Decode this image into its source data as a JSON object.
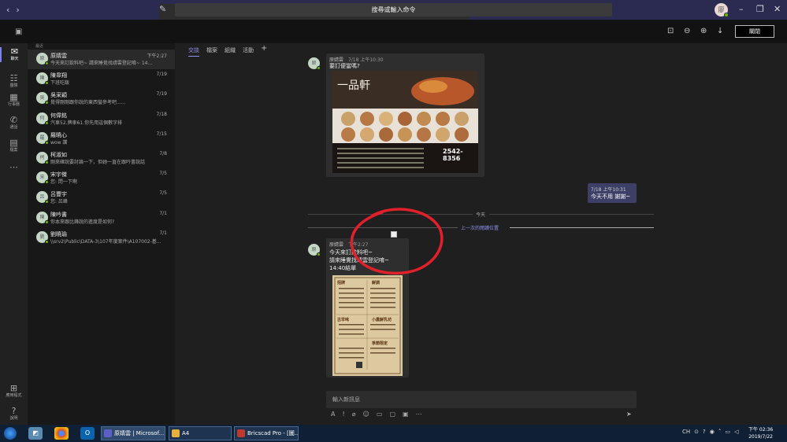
{
  "titlebar": {
    "search_placeholder": "搜尋或輸入命令",
    "avatar_initial": "廖"
  },
  "viewer_toolbar": {
    "close_label": "關閉"
  },
  "rail": [
    {
      "label": "聊天",
      "icon": "chat-icon",
      "glyph": "✉",
      "active": true
    },
    {
      "label": "團隊",
      "icon": "teams-icon",
      "glyph": "☷",
      "active": false
    },
    {
      "label": "行事曆",
      "icon": "calendar-icon",
      "glyph": "▦",
      "active": false
    },
    {
      "label": "通話",
      "icon": "phone-icon",
      "glyph": "✆",
      "active": false
    },
    {
      "label": "檔案",
      "icon": "files-icon",
      "glyph": "▤",
      "active": false
    },
    {
      "label": "",
      "icon": "more-icon",
      "glyph": "⋯",
      "active": false
    },
    {
      "label": "應用程式",
      "icon": "apps-icon",
      "glyph": "⊞",
      "active": false
    },
    {
      "label": "說明",
      "icon": "help-icon",
      "glyph": "?",
      "active": false
    }
  ],
  "chatlist": {
    "header": "最近",
    "chats": [
      {
        "name": "原婧雲",
        "preview": "今天來訂飲料吧~ 請來睡覺找靖雲登記唷~ 14...",
        "date": "下午2:27",
        "initial": "原",
        "selected": true
      },
      {
        "name": "陳韋翔",
        "preview": "下班吃飯",
        "date": "7/19",
        "initial": "陳",
        "selected": false
      },
      {
        "name": "吳采穎",
        "preview": "覺得剛剛跟你說的東西蠻參考吧......",
        "date": "7/19",
        "initial": "吳",
        "selected": false
      },
      {
        "name": "何偉銘",
        "preview": "汽車52.牌車61.你先用這個數字排",
        "date": "7/18",
        "initial": "何",
        "selected": false
      },
      {
        "name": "羅曉心",
        "preview": "wow 讚",
        "date": "7/15",
        "initial": "羅",
        "selected": false
      },
      {
        "name": "柯淑如",
        "preview": "剛來確說要討論一下，但她一直在跟吟書說話",
        "date": "7/8",
        "initial": "柯",
        "selected": false
      },
      {
        "name": "宋宇傑",
        "preview": "您: 問一下啊",
        "date": "7/5",
        "initial": "宋",
        "selected": false
      },
      {
        "name": "呂豐宇",
        "preview": "您: 呂峰",
        "date": "7/5",
        "initial": "呂",
        "selected": false
      },
      {
        "name": "陳吟書",
        "preview": "你本來跟比鋒說的進度是如何?",
        "date": "7/1",
        "initial": "陳",
        "selected": false
      },
      {
        "name": "劉曉瑜",
        "preview": "\\\\srv2\\Public\\DATA-3\\107年度案件\\A107002-基...",
        "date": "7/1",
        "initial": "劉",
        "selected": false
      }
    ]
  },
  "tabs": [
    "交談",
    "檔案",
    "組織",
    "活動"
  ],
  "messages": {
    "msg1": {
      "sender": "原婧雲",
      "time": "7/18 上午10:30",
      "text": "要訂便當嗎?",
      "initial": "原"
    },
    "poster1": {
      "brand": "一品軒",
      "phone": "2542-8356"
    },
    "my_reply": {
      "time": "7/18 上午10:31",
      "text": "今天不用 謝謝~"
    },
    "today_label": "今天",
    "last_read_label": "上一次的閱讀位置",
    "msg2": {
      "sender": "原婧雲",
      "time": "下午2:27",
      "lines": [
        "今天來訂飲料吧~",
        "請來睡覺找靖雲登記唷~",
        "14:40結單"
      ],
      "initial": "原"
    },
    "poster2": {
      "sections": [
        "招牌",
        "鮮調",
        "古早味",
        "小農鮮乳坊",
        "季節限定"
      ]
    }
  },
  "compose": {
    "placeholder": "輸入新訊息"
  },
  "taskbar": {
    "apps": [
      {
        "label": "原婧雲 | Microsof...",
        "color": "#5b5fc7"
      },
      {
        "label": "A4",
        "color": "#e8b23a"
      },
      {
        "label": "Bricscad Pro - [圖...",
        "color": "#c0392b"
      }
    ],
    "tray_lang": "CH",
    "time": "下午 02:36",
    "date": "2019/7/22"
  },
  "colors": {
    "accent": "#8d93f0",
    "titlebar": "#2b2b52",
    "annotation_red": "#e0202a"
  }
}
